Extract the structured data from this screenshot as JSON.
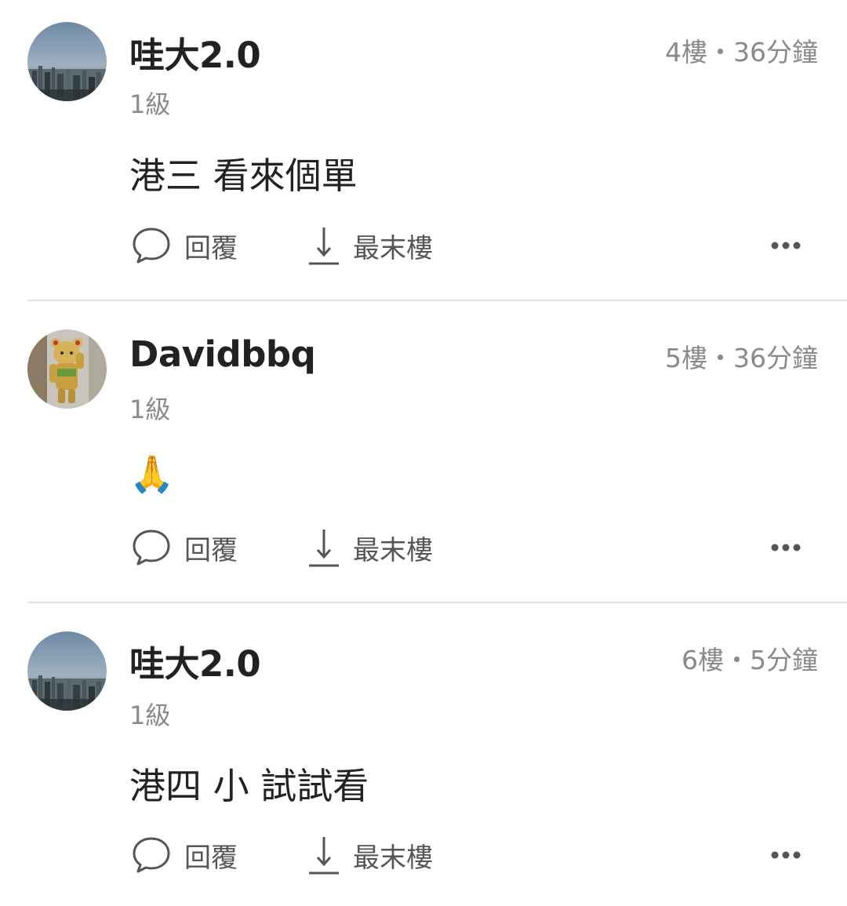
{
  "icons": {
    "reply": "speech-bubble-icon",
    "last_floor": "arrow-down-to-line-icon",
    "more": "ellipsis-icon"
  },
  "colors": {
    "username": "#222222",
    "meta": "#8a8a8a",
    "action_label": "#555555",
    "divider": "#e3e3e3"
  },
  "posts": [
    {
      "username": "哇大2.0",
      "meta": "4樓・36分鐘",
      "level": "1級",
      "content": "港三 看來個單",
      "avatar": "city-skyline-avatar",
      "actions": {
        "reply": "回覆",
        "last": "最末樓"
      }
    },
    {
      "username": "Davidbbq",
      "meta": "5樓・36分鐘",
      "level": "1級",
      "content": "🙏",
      "avatar": "gold-bear-figure-avatar",
      "actions": {
        "reply": "回覆",
        "last": "最末樓"
      }
    },
    {
      "username": "哇大2.0",
      "meta": "6樓・5分鐘",
      "level": "1級",
      "content": "港四 小 試試看",
      "avatar": "city-skyline-avatar",
      "actions": {
        "reply": "回覆",
        "last": "最末樓"
      }
    }
  ]
}
